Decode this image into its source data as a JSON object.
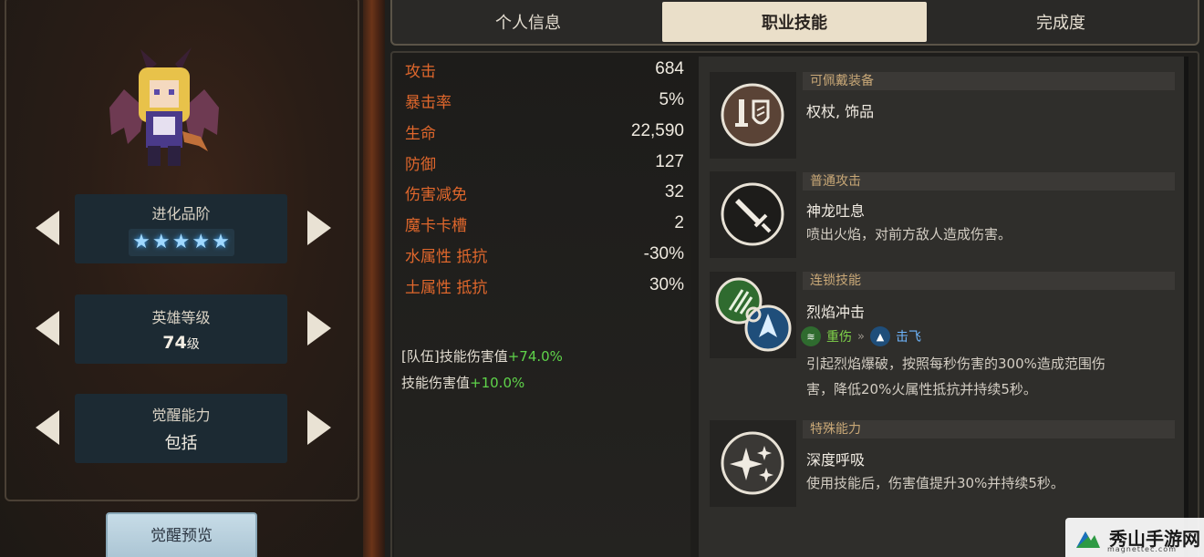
{
  "left": {
    "evolution": {
      "title": "进化品阶",
      "stars": [
        "★",
        "★",
        "★",
        "★",
        "★"
      ]
    },
    "hero_level": {
      "title": "英雄等级",
      "value": "74",
      "unit": "级"
    },
    "awakening": {
      "title": "觉醒能力",
      "value": "包括"
    },
    "awaken_preview_label": "觉醒预览"
  },
  "tabs": [
    {
      "label": "个人信息",
      "active": false
    },
    {
      "label": "职业技能",
      "active": true
    },
    {
      "label": "完成度",
      "active": false
    }
  ],
  "stats": [
    {
      "name": "攻击",
      "value": "684"
    },
    {
      "name": "暴击率",
      "value": "5%"
    },
    {
      "name": "生命",
      "value": "22,590"
    },
    {
      "name": "防御",
      "value": "127"
    },
    {
      "name": "伤害减免",
      "value": "32"
    },
    {
      "name": "魔卡卡槽",
      "value": "2"
    },
    {
      "name": "水属性 抵抗",
      "value": "-30%"
    },
    {
      "name": "土属性 抵抗",
      "value": "30%"
    }
  ],
  "bonuses": [
    {
      "label": "[队伍]技能伤害值",
      "value": "+74.0%"
    },
    {
      "label": "技能伤害值",
      "value": "+10.0%"
    }
  ],
  "skills": [
    {
      "category": "可佩戴装备",
      "name": "权杖, 饰品",
      "desc": []
    },
    {
      "category": "普通攻击",
      "name": "神龙吐息",
      "desc": [
        "喷出火焰，对前方敌人造成伤害。"
      ]
    },
    {
      "category": "连锁技能",
      "name": "烈焰冲击",
      "chain": {
        "from": "重伤",
        "to": "击飞"
      },
      "desc": [
        "引起烈焰爆破，按照每秒伤害的300%造成范围伤",
        "害，降低20%火属性抵抗并持续5秒。"
      ]
    },
    {
      "category": "特殊能力",
      "name": "深度呼吸",
      "desc": [
        "使用技能后，伤害值提升30%并持续5秒。"
      ]
    }
  ],
  "watermark": {
    "text": "秀山手游网",
    "sub": "magnettec.com"
  },
  "colors": {
    "stat_name": "#e0672c",
    "bonus_plus": "#5fd34a",
    "category": "#c9a877",
    "active_tab": "#eadfc9"
  }
}
